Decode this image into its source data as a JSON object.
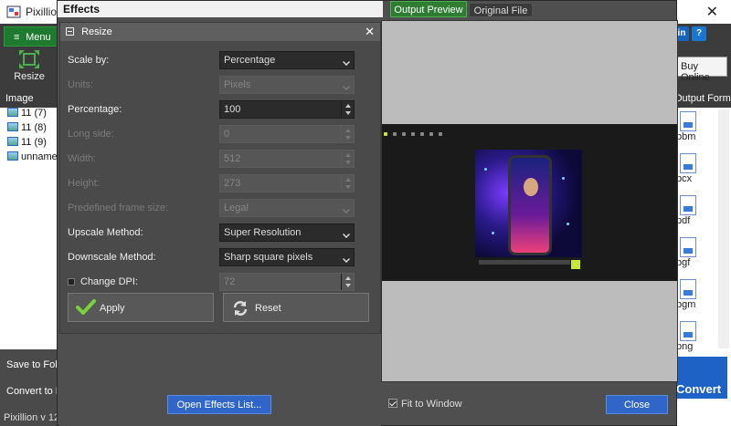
{
  "app": {
    "title": "Pixillion",
    "menu_label": "Menu",
    "resize_tool_label": "Resize",
    "buy_online_label": "Buy Online",
    "image_header": "Image",
    "images": [
      "11 (7)",
      "11 (8)",
      "11 (9)",
      "unnamed"
    ],
    "output_format_header": "Output Format",
    "formats": [
      "pbm",
      "pcx",
      "pdf",
      "pgf",
      "pgm",
      "png"
    ],
    "save_to_folder": "Save to Folder",
    "convert_to_format": "Convert to Format",
    "version": "Pixillion v 12",
    "convert_label": "Convert",
    "colors": {
      "accent_green": "#1e7a2e",
      "accent_blue": "#1d62c4"
    }
  },
  "effects": {
    "title": "Effects",
    "panel_title": "Resize",
    "fields": {
      "scale_by": {
        "label": "Scale by:",
        "value": "Percentage"
      },
      "units": {
        "label": "Units:",
        "value": "Pixels"
      },
      "percentage": {
        "label": "Percentage:",
        "value": "100"
      },
      "long_side": {
        "label": "Long side:",
        "value": "0"
      },
      "width": {
        "label": "Width:",
        "value": "512"
      },
      "height": {
        "label": "Height:",
        "value": "273"
      },
      "predefined": {
        "label": "Predefined frame size:",
        "value": "Legal"
      },
      "upscale": {
        "label": "Upscale Method:",
        "value": "Super Resolution"
      },
      "downscale": {
        "label": "Downscale Method:",
        "value": "Sharp square pixels"
      },
      "change_dpi": {
        "label": "Change DPI:",
        "value": "72"
      }
    },
    "apply_label": "Apply",
    "reset_label": "Reset",
    "open_effects_list_label": "Open Effects List...",
    "fit_to_window_label": "Fit to Window",
    "close_label": "Close",
    "tabs": {
      "output_preview": "Output Preview",
      "original_file": "Original File"
    }
  }
}
